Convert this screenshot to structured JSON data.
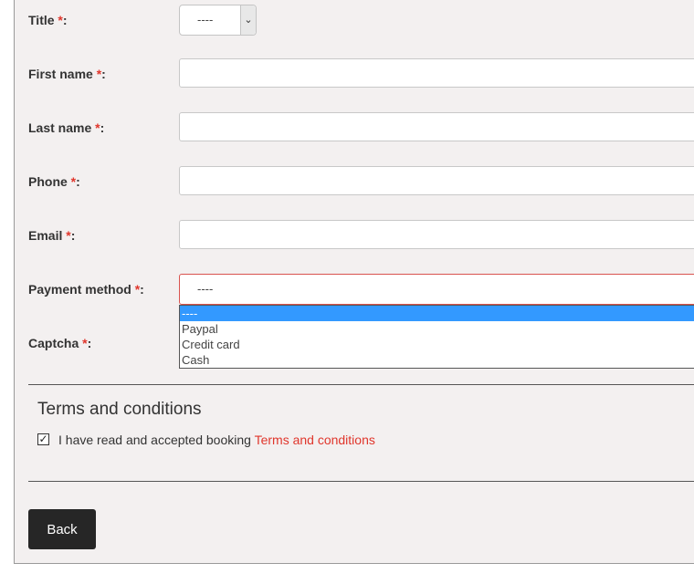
{
  "form": {
    "title_label": "Title",
    "title_value": "----",
    "first_name_label": "First name",
    "last_name_label": "Last name",
    "phone_label": "Phone",
    "email_label": "Email",
    "payment_label": "Payment method",
    "payment_value": "----",
    "payment_options": [
      "----",
      "Paypal",
      "Credit card",
      "Cash"
    ],
    "captcha_label": "Captcha",
    "required_mark": "*",
    "colon": ":"
  },
  "terms": {
    "heading": "Terms and conditions",
    "checkbox_checked": true,
    "text": "I have read and accepted booking ",
    "link_text": "Terms and conditions"
  },
  "actions": {
    "back_label": "Back"
  },
  "colors": {
    "required": "#e0362c",
    "link": "#e0362c",
    "selected_option": "#3399ff",
    "button_bg": "#262626"
  }
}
